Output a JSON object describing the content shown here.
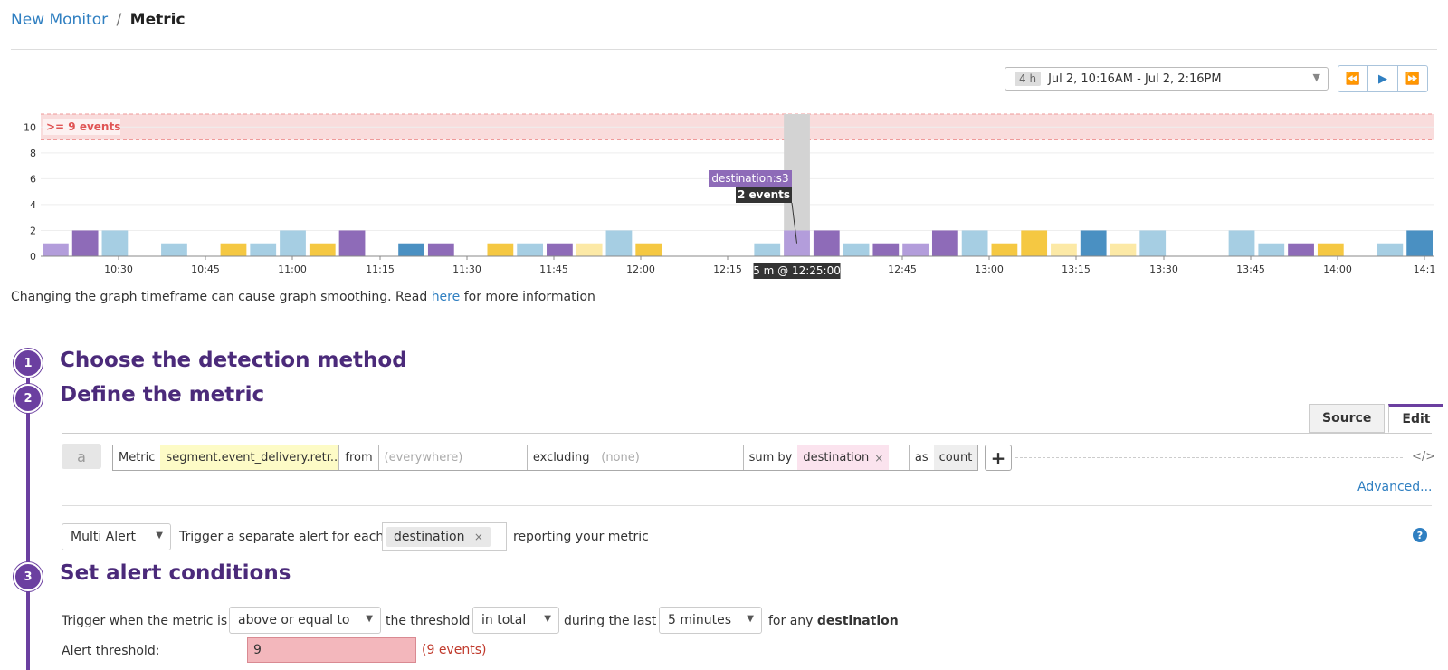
{
  "breadcrumb": {
    "parent": "New Monitor",
    "separator": "/",
    "current": "Metric"
  },
  "timeframe": {
    "badge": "4 h",
    "range": "Jul 2, 10:16AM - Jul 2, 2:16PM"
  },
  "chart_data": {
    "type": "bar",
    "y_ticks": [
      "0",
      "2",
      "4",
      "6",
      "8",
      "10"
    ],
    "ylim": [
      0,
      11
    ],
    "x_tick_labels": [
      "10:30",
      "10:45",
      "11:00",
      "11:15",
      "11:30",
      "11:45",
      "12:00",
      "12:15",
      "12:45",
      "13:00",
      "13:15",
      "13:30",
      "13:45",
      "14:00",
      "14:1"
    ],
    "threshold": {
      "label": ">= 9 events",
      "from": 9,
      "to": 11,
      "color": "#f9dcdc"
    },
    "bar_values": [
      1,
      2,
      2,
      0,
      1,
      0,
      1,
      1,
      2,
      1,
      2,
      0,
      1,
      1,
      0,
      1,
      1,
      1,
      1,
      2,
      1,
      0,
      0,
      0,
      1,
      2,
      2,
      1,
      1,
      1,
      2,
      2,
      1,
      2,
      1,
      2,
      1,
      2,
      0,
      0,
      2,
      1,
      1,
      1,
      0,
      1,
      2
    ],
    "bar_colors": [
      "#b39ddb",
      "#8e6bb8",
      "#a6cee3",
      "",
      "#a6cee3",
      "",
      "#f5c842",
      "#a6cee3",
      "#a6cee3",
      "#f5c842",
      "#8e6bb8",
      "",
      "#4a90c2",
      "#8e6bb8",
      "",
      "#f5c842",
      "#a6cee3",
      "#8e6bb8",
      "#fce9a6",
      "#a6cee3",
      "#f5c842",
      "",
      "",
      "",
      "#a6cee3",
      "#b39ddb",
      "#8e6bb8",
      "#a6cee3",
      "#8e6bb8",
      "#b39ddb",
      "#8e6bb8",
      "#a6cee3",
      "#f5c842",
      "#f5c842",
      "#fce9a6",
      "#4a90c2",
      "#fce9a6",
      "#a6cee3",
      "#a6cee3",
      "",
      "",
      "#a6cee3",
      "#8e6bb8",
      "#f5c842",
      "#4a90c2",
      "",
      "#4a90c2",
      "#a6cee3"
    ],
    "highlight_index": 25,
    "tooltip": {
      "series": "destination:s3",
      "value": "2 events",
      "time": "5 m @ 12:25:00"
    }
  },
  "hint": {
    "before": "Changing the graph timeframe can cause graph smoothing. Read ",
    "link": "here",
    "after": " for more information"
  },
  "steps": [
    {
      "number": "1",
      "title": "Choose the detection method"
    },
    {
      "number": "2",
      "title": "Define the metric"
    },
    {
      "number": "3",
      "title": "Set alert conditions"
    }
  ],
  "tabs": {
    "source": "Source",
    "edit": "Edit"
  },
  "query": {
    "label": "a",
    "metric_label": "Metric",
    "metric_value": "segment.event_delivery.retr...",
    "from_label": "from",
    "from_placeholder": "(everywhere)",
    "excluding_label": "excluding",
    "excluding_placeholder": "(none)",
    "sumby_label": "sum by",
    "sumby_tag": "destination",
    "as_label": "as",
    "as_value": "count",
    "plus": "+",
    "code_icon": "</>",
    "remove": "×"
  },
  "advanced": "Advanced...",
  "multi_alert": {
    "select": "Multi Alert",
    "text_before": "Trigger a separate alert for each",
    "tag": "destination",
    "remove": "×",
    "text_after": "reporting your metric",
    "help": "?"
  },
  "conditions": {
    "prefix": "Trigger when the metric is",
    "comparator": "above or equal to",
    "mid1": "the threshold",
    "aggregation": "in total",
    "mid2": "during the last",
    "window": "5 minutes",
    "mid3": "for any",
    "group": "destination"
  },
  "threshold": {
    "label": "Alert threshold:",
    "value": "9",
    "note": "(9 events)"
  },
  "icons": {
    "rewind": "⏪",
    "play": "▶",
    "forward": "⏩",
    "caret": "▼"
  }
}
